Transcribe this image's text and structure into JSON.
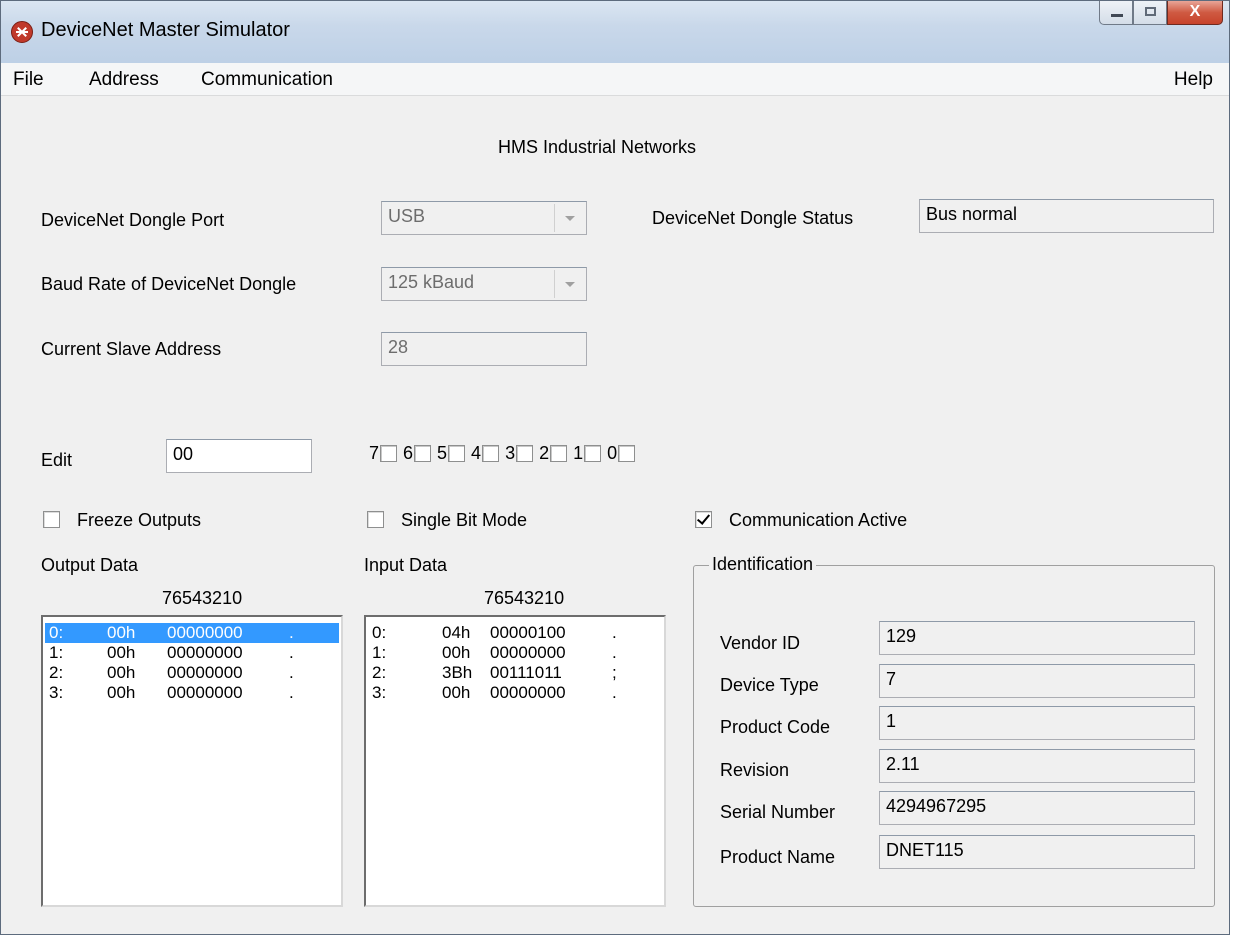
{
  "window": {
    "title": "DeviceNet Master Simulator",
    "close_glyph": "X"
  },
  "menu": {
    "file": "File",
    "address": "Address",
    "communication": "Communication",
    "help": "Help"
  },
  "header": {
    "company": "HMS Industrial Networks"
  },
  "dongle": {
    "port_label": "DeviceNet Dongle Port",
    "port_value": "USB",
    "status_label": "DeviceNet Dongle Status",
    "status_value": "Bus normal",
    "baud_label": "Baud Rate of DeviceNet Dongle",
    "baud_value": "125 kBaud",
    "slave_label": "Current Slave Address",
    "slave_value": "28"
  },
  "edit": {
    "label": "Edit",
    "value": "00",
    "bits": [
      "7",
      "6",
      "5",
      "4",
      "3",
      "2",
      "1",
      "0"
    ]
  },
  "options": {
    "freeze_outputs": "Freeze Outputs",
    "freeze_checked": false,
    "single_bit_mode": "Single Bit Mode",
    "single_bit_checked": false,
    "communication_active": "Communication Active",
    "communication_checked": true
  },
  "output_data": {
    "label": "Output Data",
    "bit_header": "76543210",
    "rows": [
      {
        "index": "0:",
        "hex": "00h",
        "bin": "00000000",
        "ch": ".",
        "selected": true
      },
      {
        "index": "1:",
        "hex": "00h",
        "bin": "00000000",
        "ch": ".",
        "selected": false
      },
      {
        "index": "2:",
        "hex": "00h",
        "bin": "00000000",
        "ch": ".",
        "selected": false
      },
      {
        "index": "3:",
        "hex": "00h",
        "bin": "00000000",
        "ch": ".",
        "selected": false
      }
    ]
  },
  "input_data": {
    "label": "Input Data",
    "bit_header": "76543210",
    "rows": [
      {
        "index": "0:",
        "hex": "04h",
        "bin": "00000100",
        "ch": "."
      },
      {
        "index": "1:",
        "hex": "00h",
        "bin": "00000000",
        "ch": "."
      },
      {
        "index": "2:",
        "hex": "3Bh",
        "bin": "00111011",
        "ch": ";"
      },
      {
        "index": "3:",
        "hex": "00h",
        "bin": "00000000",
        "ch": "."
      }
    ]
  },
  "identification": {
    "title": "Identification",
    "fields": [
      {
        "label": "Vendor ID",
        "value": "129"
      },
      {
        "label": "Device Type",
        "value": "7"
      },
      {
        "label": "Product Code",
        "value": "1"
      },
      {
        "label": "Revision",
        "value": "2.11"
      },
      {
        "label": "Serial Number",
        "value": "4294967295"
      },
      {
        "label": "Product Name",
        "value": "DNET115"
      }
    ]
  }
}
